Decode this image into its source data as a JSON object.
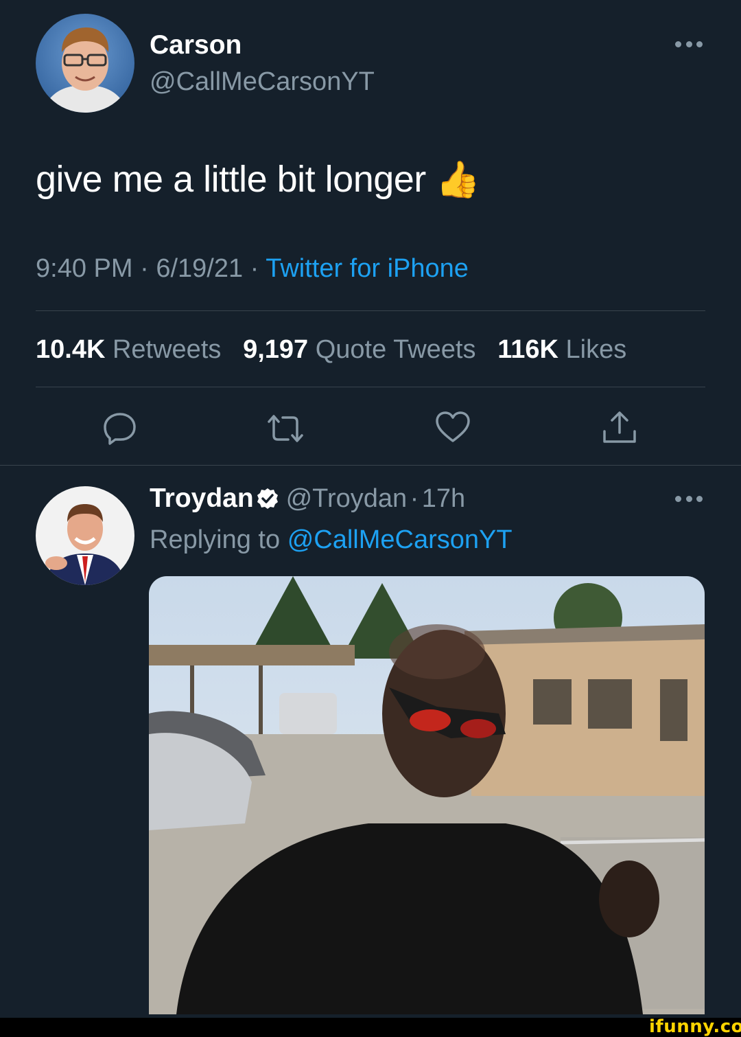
{
  "tweet": {
    "author_name": "Carson",
    "author_handle": "@CallMeCarsonYT",
    "text": "give me a little bit longer",
    "emoji": "👍",
    "time": "9:40 PM",
    "date": "6/19/21",
    "source": "Twitter for iPhone",
    "separator": "·",
    "stats": {
      "retweets_count": "10.4K",
      "retweets_label": "Retweets",
      "quotes_count": "9,197",
      "quotes_label": "Quote Tweets",
      "likes_count": "116K",
      "likes_label": "Likes"
    },
    "actions": [
      "reply-icon",
      "retweet-icon",
      "like-icon",
      "share-icon"
    ]
  },
  "reply": {
    "author_name": "Troydan",
    "author_handle": "@Troydan",
    "age": "17h",
    "separator": "·",
    "replying_prefix": "Replying to",
    "replying_to": "@CallMeCarsonYT"
  },
  "watermark": "ifunny.co",
  "colors": {
    "background": "#15202b",
    "secondary_text": "#8899a6",
    "link": "#1da1f2",
    "divider": "#38444d",
    "verified": "#ffffff"
  }
}
